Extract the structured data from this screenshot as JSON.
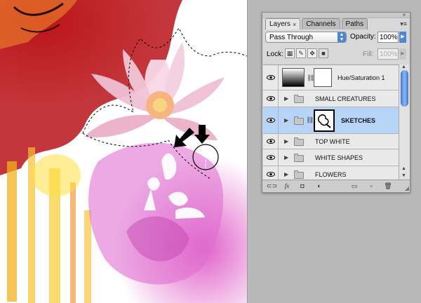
{
  "panel": {
    "tabs": [
      {
        "label": "Layers",
        "active": true,
        "close": "×"
      },
      {
        "label": "Channels",
        "active": false
      },
      {
        "label": "Paths",
        "active": false
      }
    ],
    "close_glyph": "×",
    "menu_glyph": "▾≡",
    "blend_mode": "Pass Through",
    "opacity_label": "Opacity:",
    "opacity_value": "100%",
    "lock_label": "Lock:",
    "fill_label": "Fill:",
    "fill_value": "100%",
    "lock_icons": [
      "transparency-lock-icon",
      "brush-lock-icon",
      "move-lock-icon",
      "padlock-icon"
    ],
    "layers": [
      {
        "name": "Hue/Saturation 1",
        "type": "adjustment",
        "visible": true,
        "selected": false
      },
      {
        "name": "SMALL CREATURES",
        "type": "group",
        "visible": true,
        "selected": false
      },
      {
        "name": "SKETCHES",
        "type": "group-with-mask",
        "visible": true,
        "selected": true
      },
      {
        "name": "TOP WHITE",
        "type": "group",
        "visible": true,
        "selected": false
      },
      {
        "name": "WHITE SHAPES",
        "type": "group",
        "visible": true,
        "selected": false
      },
      {
        "name": "FLOWERS",
        "type": "group",
        "visible": true,
        "selected": false
      }
    ],
    "bottom_buttons": [
      {
        "name": "link-layers-icon",
        "glyph": "⊂⊃"
      },
      {
        "name": "layer-style-icon",
        "glyph": "fx"
      },
      {
        "name": "add-mask-icon",
        "glyph": "◘"
      },
      {
        "name": "adjustment-layer-icon",
        "glyph": "◐"
      },
      {
        "name": "new-group-icon",
        "glyph": "▭"
      },
      {
        "name": "new-layer-icon",
        "glyph": "▫"
      },
      {
        "name": "trash-icon",
        "glyph": "🗑"
      }
    ],
    "accent": "#4d86d9",
    "selection_color": "#b6d4f7"
  }
}
